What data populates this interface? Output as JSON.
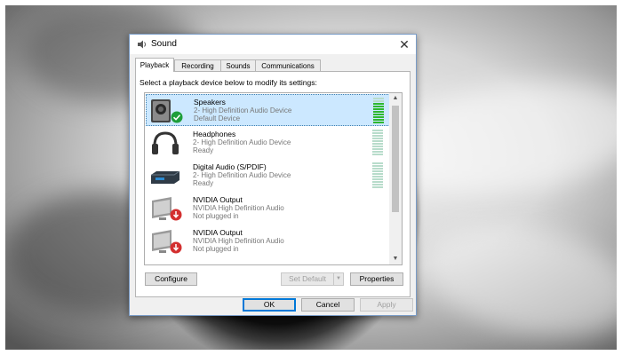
{
  "window": {
    "title": "Sound"
  },
  "icons": {
    "title": "speaker-icon",
    "close": "close-icon"
  },
  "tabs": [
    {
      "label": "Playback",
      "active": true
    },
    {
      "label": "Recording",
      "active": false
    },
    {
      "label": "Sounds",
      "active": false
    },
    {
      "label": "Communications",
      "active": false
    }
  ],
  "instructions": "Select a playback device below to modify its settings:",
  "devices": [
    {
      "name": "Speakers",
      "description": "2- High Definition Audio Device",
      "status": "Default Device",
      "icon": "speakers-icon",
      "badge": "check",
      "selected": true,
      "level": 0.8
    },
    {
      "name": "Headphones",
      "description": "2- High Definition Audio Device",
      "status": "Ready",
      "icon": "headphones-icon",
      "badge": "",
      "selected": false,
      "level": 0
    },
    {
      "name": "Digital Audio (S/PDIF)",
      "description": "2- High Definition Audio Device",
      "status": "Ready",
      "icon": "digital-audio-icon",
      "badge": "",
      "selected": false,
      "level": 0
    },
    {
      "name": "NVIDIA Output",
      "description": "NVIDIA High Definition Audio",
      "status": "Not plugged in",
      "icon": "monitor-icon",
      "badge": "unplugged",
      "selected": false,
      "level": null
    },
    {
      "name": "NVIDIA Output",
      "description": "NVIDIA High Definition Audio",
      "status": "Not plugged in",
      "icon": "monitor-icon",
      "badge": "unplugged",
      "selected": false,
      "level": null
    }
  ],
  "buttons": {
    "configure": "Configure",
    "set_default": "Set Default",
    "properties": "Properties",
    "ok": "OK",
    "cancel": "Cancel",
    "apply": "Apply"
  },
  "colors": {
    "selection": "#cce8ff",
    "meter_active": "#2eb82e",
    "meter_idle": "#b8dccb",
    "default_badge": "#1e9e3a",
    "unplugged_badge": "#d32f2f"
  }
}
